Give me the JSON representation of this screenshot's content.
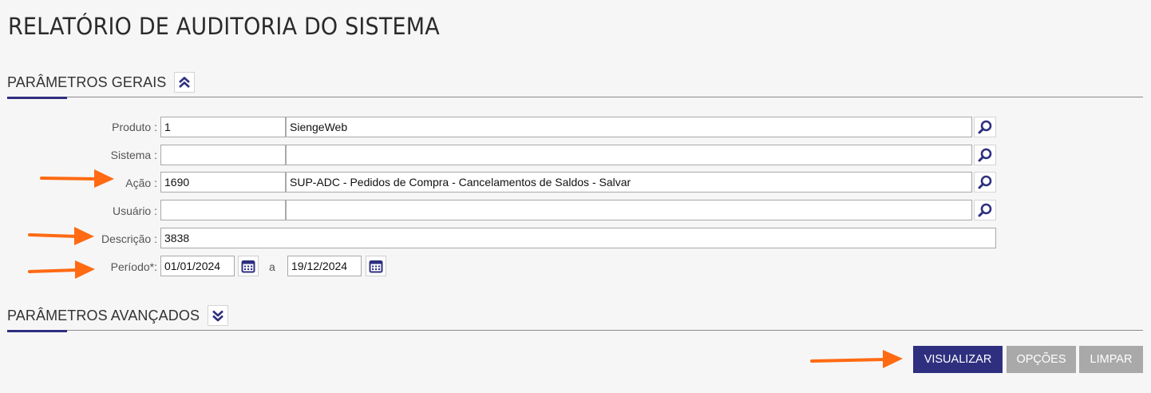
{
  "page": {
    "title": "RELATÓRIO DE AUDITORIA DO SISTEMA"
  },
  "sections": {
    "general": {
      "label": "PARÂMETROS GERAIS",
      "toggle_icon": "chevron-double-up-icon"
    },
    "advanced": {
      "label": "PARÂMETROS AVANÇADOS",
      "toggle_icon": "chevron-double-down-icon"
    }
  },
  "form": {
    "produto": {
      "label": "Produto :",
      "code": "1",
      "description": "SiengeWeb"
    },
    "sistema": {
      "label": "Sistema :",
      "code": "",
      "description": ""
    },
    "acao": {
      "label": "Ação :",
      "code": "1690",
      "description": "SUP-ADC - Pedidos de Compra - Cancelamentos de Saldos - Salvar"
    },
    "usuario": {
      "label": "Usuário :",
      "code": "",
      "description": ""
    },
    "descricao": {
      "label": "Descrição :",
      "value": "3838"
    },
    "periodo": {
      "label": "Período*:",
      "start": "01/01/2024",
      "separator": "a",
      "end": "19/12/2024"
    }
  },
  "actions": {
    "visualizar": "VISUALIZAR",
    "opcoes": "OPÇÕES",
    "limpar": "LIMPAR"
  },
  "colors": {
    "primary": "#2e2f7f",
    "button_disabled": "#a9a9a9",
    "annotation_arrow": "#ff6a13"
  }
}
